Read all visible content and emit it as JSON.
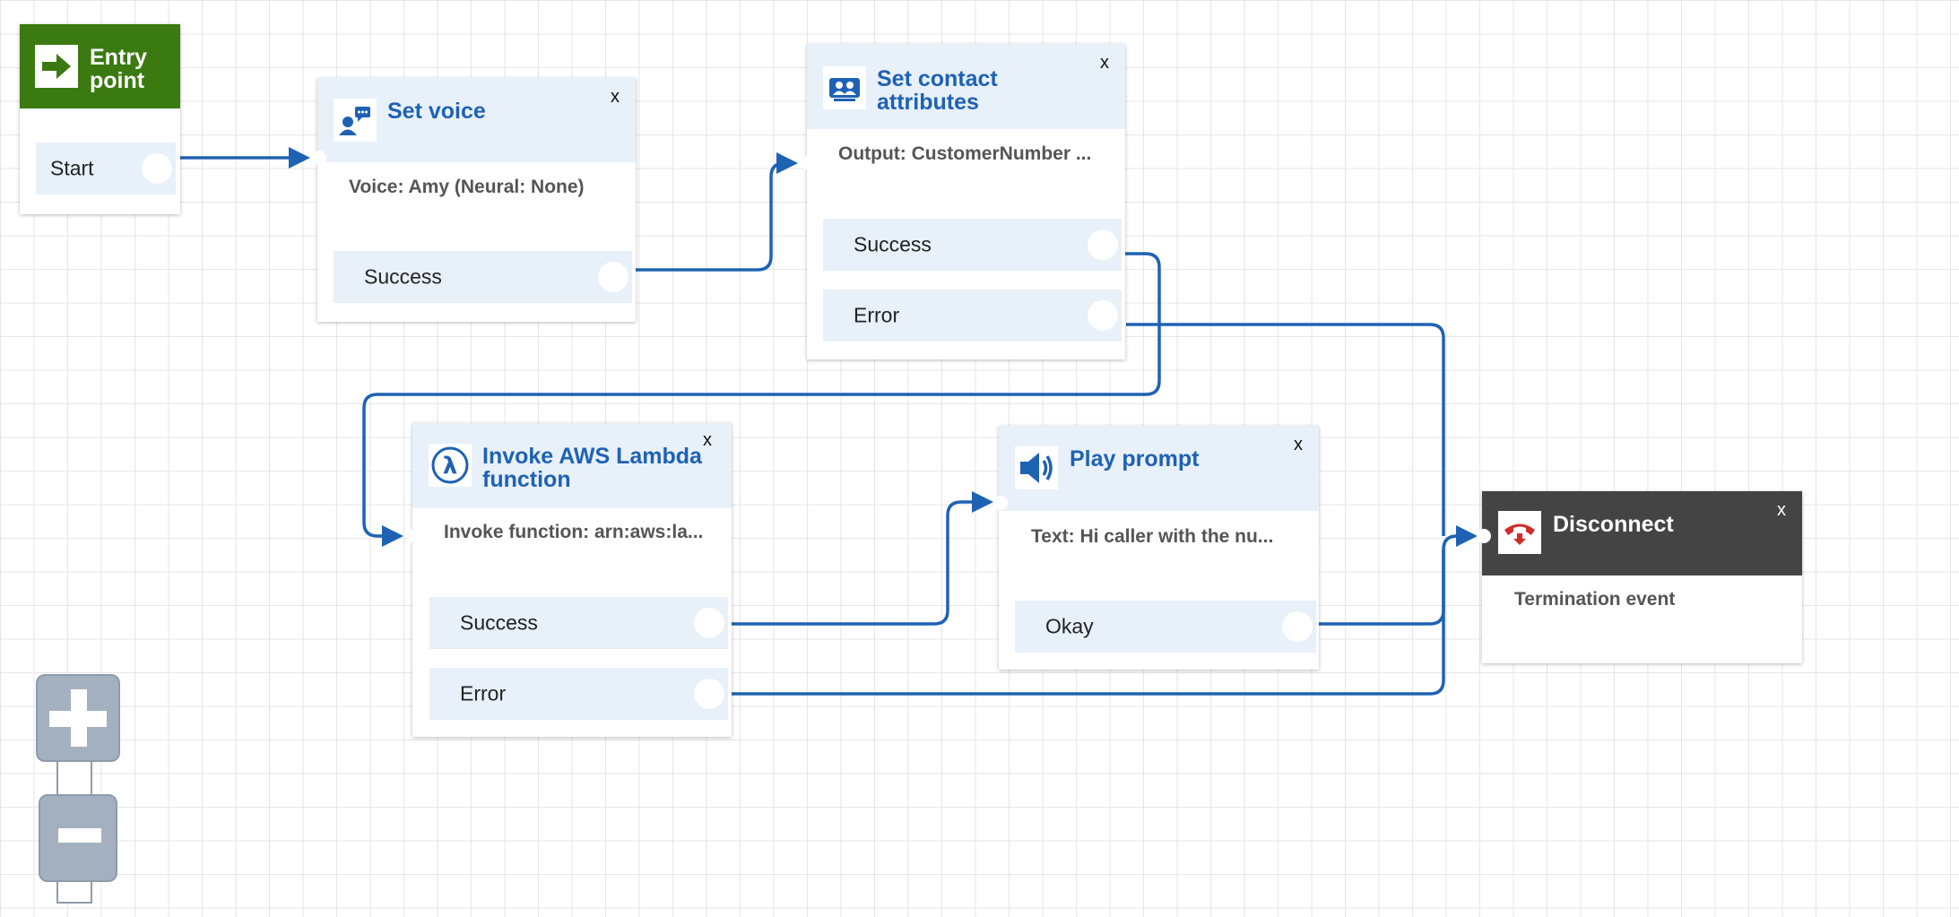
{
  "colors": {
    "accent_title": "#1e62b4",
    "entry_header": "#3a7a10",
    "disconnect_header": "#444444",
    "wire": "#1e62b4",
    "branch_bg": "#e8f0f9"
  },
  "entry": {
    "title": "Entry point",
    "icon": "arrow-right-icon",
    "start_label": "Start"
  },
  "set_voice": {
    "title": "Set voice",
    "icon": "voice-settings-icon",
    "close": "x",
    "description": "Voice: Amy (Neural: None)",
    "branches": [
      "Success"
    ]
  },
  "set_contact_attributes": {
    "title_line1": "Set contact",
    "title_line2": "attributes",
    "icon": "contact-attributes-icon",
    "close": "x",
    "description": "Output: CustomerNumber ...",
    "branches": [
      "Success",
      "Error"
    ]
  },
  "invoke_lambda": {
    "title_line1": "Invoke AWS Lambda",
    "title_line2": "function",
    "icon": "lambda-icon",
    "close": "x",
    "description": "Invoke function: arn:aws:la...",
    "branches": [
      "Success",
      "Error"
    ]
  },
  "play_prompt": {
    "title": "Play prompt",
    "icon": "speaker-icon",
    "close": "x",
    "description": "Text: Hi caller with the nu...",
    "branches": [
      "Okay"
    ]
  },
  "disconnect": {
    "title": "Disconnect",
    "icon": "hang-up-phone-icon",
    "close": "x",
    "description": "Termination event"
  },
  "zoom_controls": {
    "zoom_in_icon": "plus-icon",
    "zoom_out_icon": "minus-icon"
  }
}
